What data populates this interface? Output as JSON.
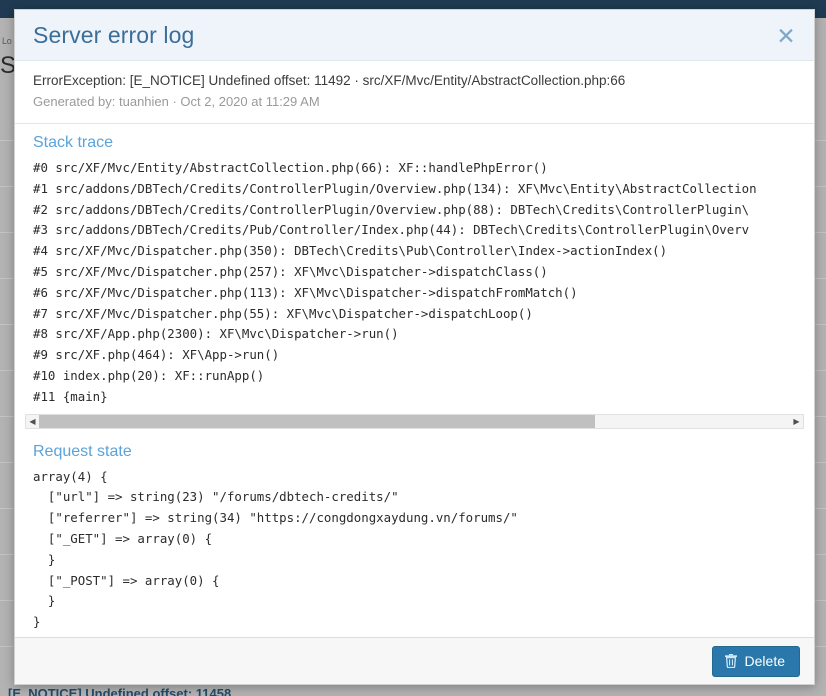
{
  "background": {
    "breadcrumb": "Lo",
    "heading": "S",
    "bottom_text": "[E_NOTICE] Undefined offset: 11458",
    "topbar_color": "#1f3a52"
  },
  "dialog": {
    "title": "Server error log",
    "close_icon": "close-icon",
    "close_glyph": "✕",
    "exception_line": "ErrorException: [E_NOTICE] Undefined offset: 11492 · src/XF/Mvc/Entity/AbstractCollection.php:66",
    "generated_line": "Generated by: tuanhien · Oct 2, 2020 at 11:29 AM",
    "stack_trace": {
      "title": "Stack trace",
      "lines": [
        "#0 src/XF/Mvc/Entity/AbstractCollection.php(66): XF::handlePhpError()",
        "#1 src/addons/DBTech/Credits/ControllerPlugin/Overview.php(134): XF\\Mvc\\Entity\\AbstractCollection",
        "#2 src/addons/DBTech/Credits/ControllerPlugin/Overview.php(88): DBTech\\Credits\\ControllerPlugin\\",
        "#3 src/addons/DBTech/Credits/Pub/Controller/Index.php(44): DBTech\\Credits\\ControllerPlugin\\Overv",
        "#4 src/XF/Mvc/Dispatcher.php(350): DBTech\\Credits\\Pub\\Controller\\Index->actionIndex()",
        "#5 src/XF/Mvc/Dispatcher.php(257): XF\\Mvc\\Dispatcher->dispatchClass()",
        "#6 src/XF/Mvc/Dispatcher.php(113): XF\\Mvc\\Dispatcher->dispatchFromMatch()",
        "#7 src/XF/Mvc/Dispatcher.php(55): XF\\Mvc\\Dispatcher->dispatchLoop()",
        "#8 src/XF/App.php(2300): XF\\Mvc\\Dispatcher->run()",
        "#9 src/XF.php(464): XF\\App->run()",
        "#10 index.php(20): XF::runApp()",
        "#11 {main}"
      ],
      "scrollbar": {
        "left_arrow": "◀",
        "right_arrow": "▶",
        "thumb_width_percent": 74
      }
    },
    "request_state": {
      "title": "Request state",
      "lines": [
        "array(4) {",
        "  [\"url\"] => string(23) \"/forums/dbtech-credits/\"",
        "  [\"referrer\"] => string(34) \"https://congdongxaydung.vn/forums/\"",
        "  [\"_GET\"] => array(0) {",
        "  }",
        "  [\"_POST\"] => array(0) {",
        "  }",
        "}"
      ]
    },
    "footer": {
      "delete_label": "Delete",
      "delete_icon": "trash-icon",
      "delete_color": "#2a78ab"
    }
  }
}
